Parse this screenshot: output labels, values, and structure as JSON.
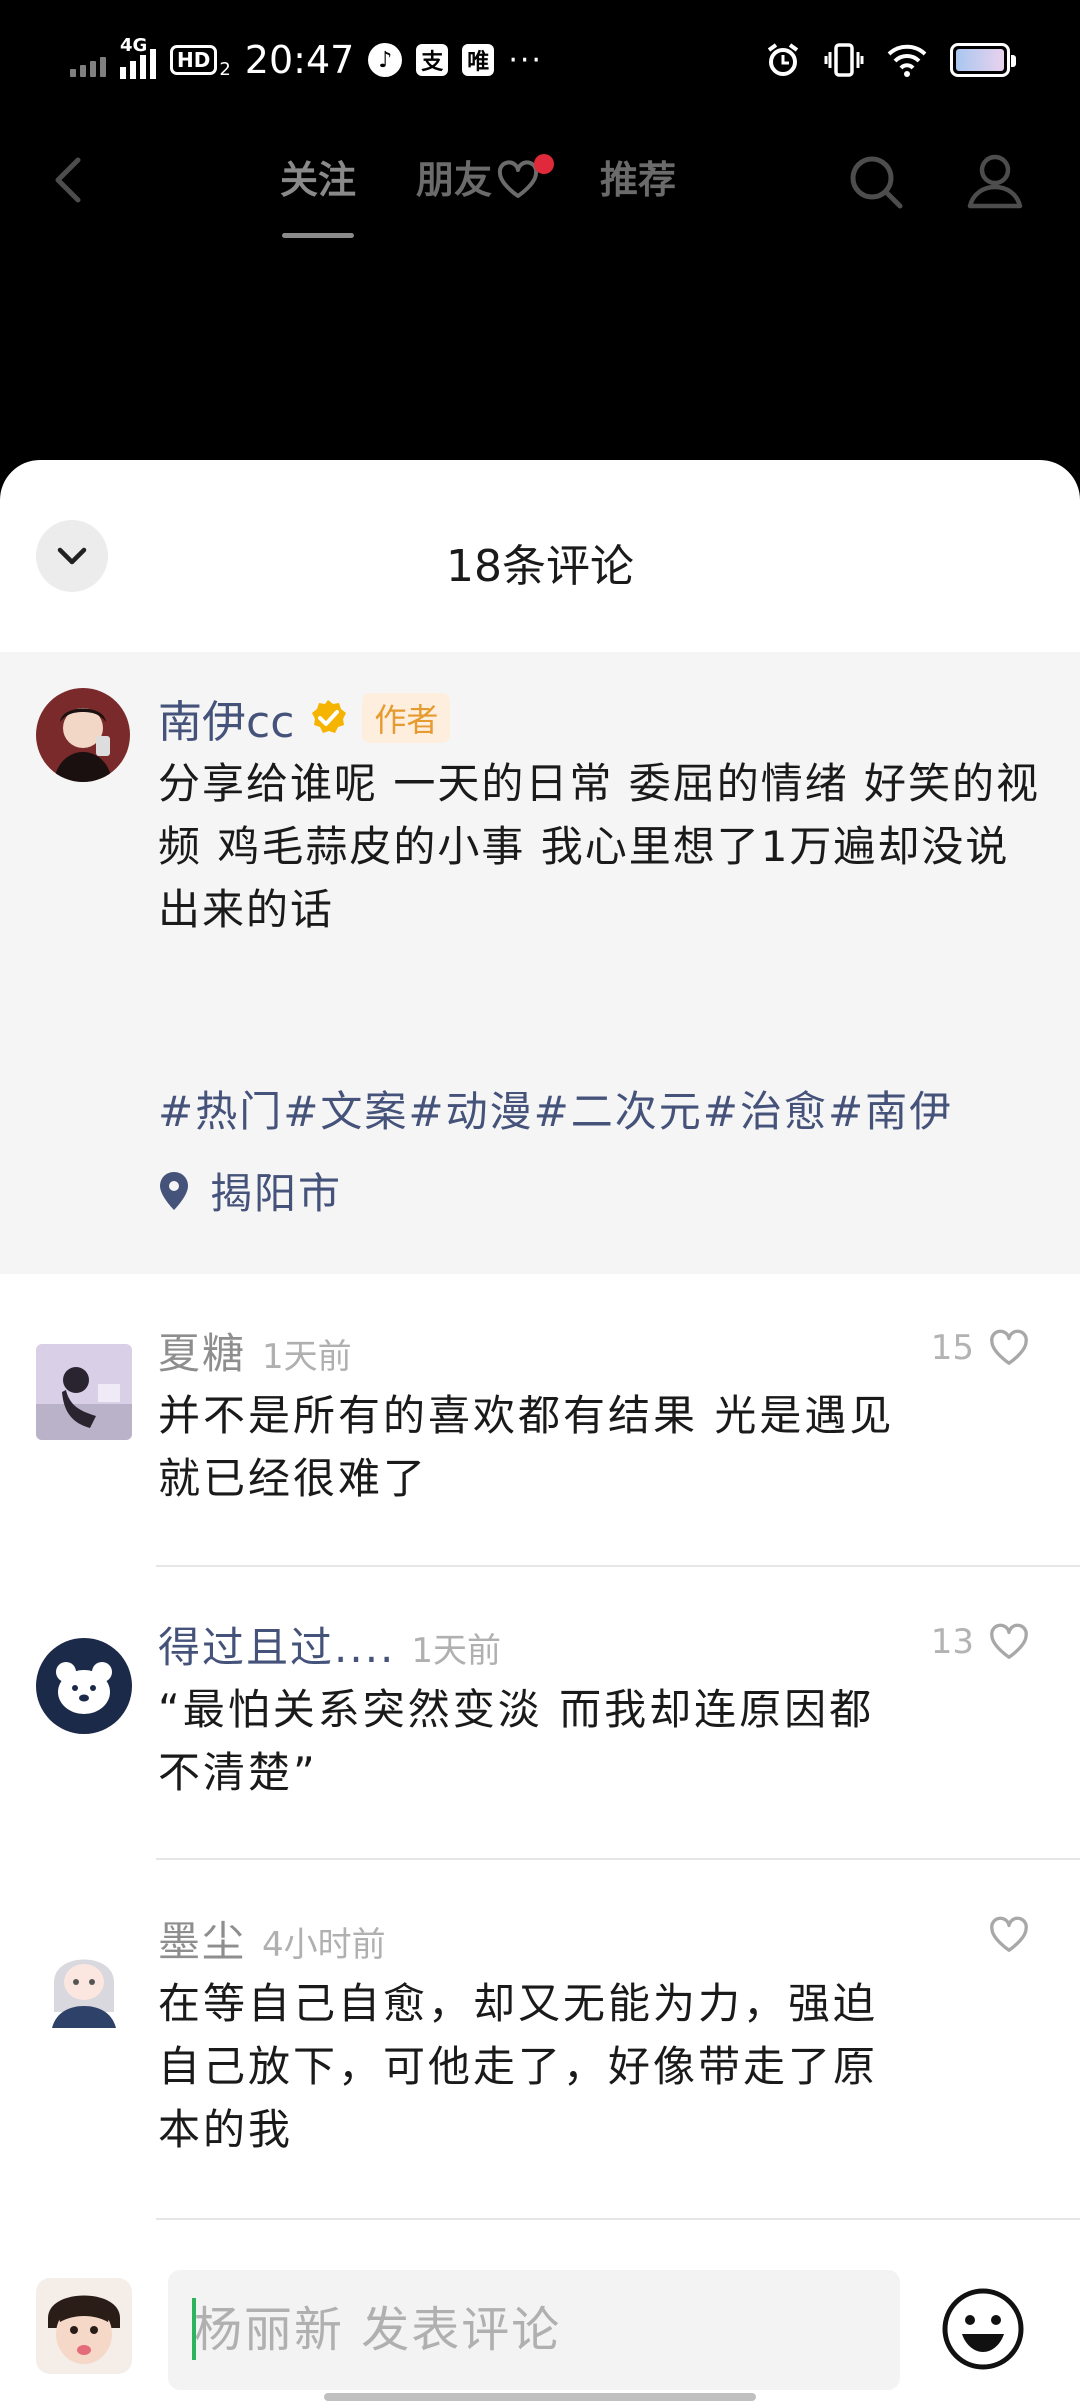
{
  "status_bar": {
    "network": "4G",
    "hd": "HD",
    "hd_sub": "2",
    "time": "20:47",
    "app_icon_1": "music-icon",
    "app_icon_2": "支",
    "app_icon_3": "唯",
    "more": "···"
  },
  "nav": {
    "tabs": [
      {
        "label": "关注",
        "active": true
      },
      {
        "label": "朋友",
        "active": false,
        "badge": true
      },
      {
        "label": "推荐",
        "active": false
      }
    ]
  },
  "sheet": {
    "title": "18条评论"
  },
  "author_post": {
    "name": "南伊cc",
    "tag": "作者",
    "text": "分享给谁呢 一天的日常 委屈的情绪 好笑的视频 鸡毛蒜皮的小事 我心里想了1万遍却没说出来的话",
    "hashtags": "#热门#文案#动漫#二次元#治愈#南伊",
    "location": "揭阳市"
  },
  "comments": [
    {
      "name": "夏糖",
      "time": "1天前",
      "text": "并不是所有的喜欢都有结果 光是遇见就已经很难了",
      "likes": "15"
    },
    {
      "name": "得过且过....",
      "time": "1天前",
      "text": "“最怕关系突然变淡 而我却连原因都不清楚”",
      "likes": "13"
    },
    {
      "name": "墨尘",
      "time": "4小时前",
      "text": "在等自己自愈，却又无能为力，强迫自己放下，可他走了，好像带走了原本的我",
      "likes": ""
    }
  ],
  "input": {
    "placeholder": "杨丽新 发表评论"
  },
  "colors": {
    "link_blue": "#45527a",
    "author_tag": "#e59b2f",
    "red_badge": "#e02a3b",
    "verified": "#f5b400",
    "cursor": "#2db35a"
  }
}
